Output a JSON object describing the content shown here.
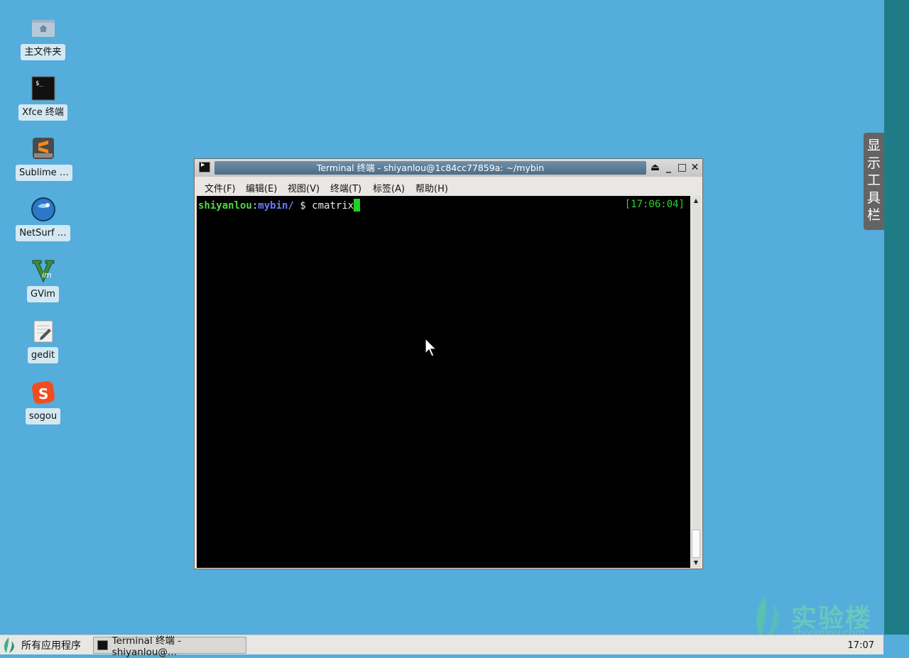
{
  "desktop": {
    "icons": [
      {
        "label": "主文件夹",
        "icon": "home-folder-icon"
      },
      {
        "label": "Xfce 终端",
        "icon": "terminal-icon"
      },
      {
        "label": "Sublime …",
        "icon": "sublime-icon"
      },
      {
        "label": "NetSurf …",
        "icon": "netsurf-icon"
      },
      {
        "label": "GVim",
        "icon": "gvim-icon"
      },
      {
        "label": "gedit",
        "icon": "gedit-icon"
      },
      {
        "label": "sogou",
        "icon": "sogou-icon"
      }
    ]
  },
  "side_toolbar": {
    "label_chars": [
      "显",
      "示",
      "工",
      "具",
      "栏"
    ]
  },
  "window": {
    "title": "Terminal 终端 - shiyanlou@1c84cc77859a: ~/mybin",
    "menu": [
      "文件(F)",
      "编辑(E)",
      "视图(V)",
      "终端(T)",
      "标签(A)",
      "帮助(H)"
    ],
    "terminal": {
      "user": "shiyanlou",
      "colon": ":",
      "dir": "mybin/",
      "prompt_symbol": " $ ",
      "command": "cmatrix",
      "time": "[17:06:04]"
    }
  },
  "watermark": {
    "brand": "实验楼",
    "domain": "shiyanlou.com"
  },
  "taskbar": {
    "start_label": "所有应用程序",
    "task_label": "Terminal 终端 - shiyanlou@…",
    "clock": "17:07"
  },
  "colors": {
    "desktop": "#54addb",
    "prompt_user": "#55d64a",
    "prompt_dir": "#6a7cf6",
    "cursor": "#1fd21f"
  }
}
